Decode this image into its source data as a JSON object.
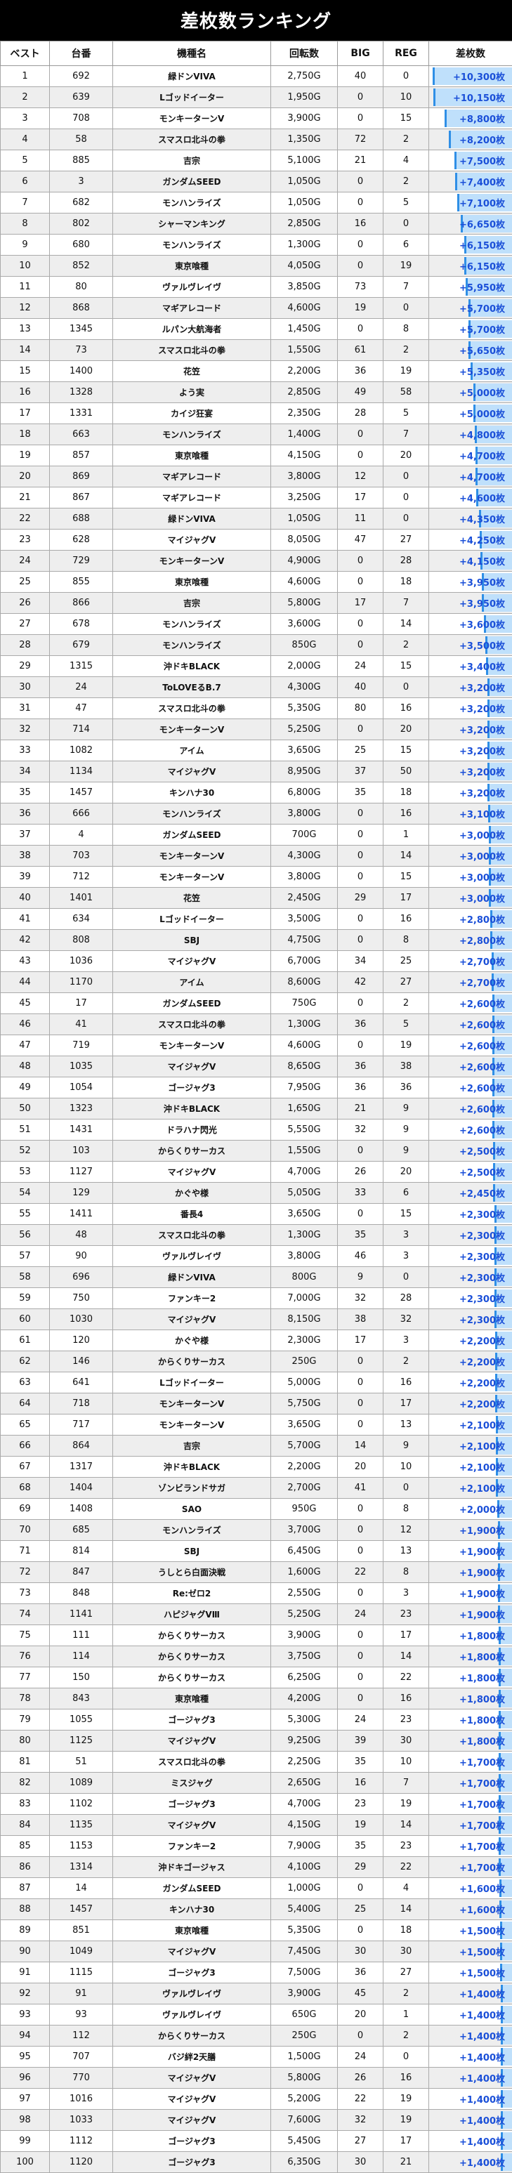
{
  "title": "差枚数ランキング",
  "headers": {
    "rank": "ベスト",
    "no": "台番",
    "name": "機種名",
    "spins": "回転数",
    "big": "BIG",
    "reg": "REG",
    "diff": "差枚数"
  },
  "bar_color": "#bfe0fb",
  "bar_edge_color": "#2f8fe6",
  "value_color": "#1a4fd8",
  "rows": [
    {
      "rank": "1",
      "no": "692",
      "name": "緑ドンVIVA",
      "spins": "2,750G",
      "big": "40",
      "reg": "0",
      "diff": "+10,300枚",
      "level": 1.0
    },
    {
      "rank": "2",
      "no": "639",
      "name": "Lゴッドイーター",
      "spins": "1,950G",
      "big": "0",
      "reg": "10",
      "diff": "+10,150枚",
      "level": 0.99
    },
    {
      "rank": "3",
      "no": "708",
      "name": "モンキーターンV",
      "spins": "3,900G",
      "big": "0",
      "reg": "15",
      "diff": "+8,800枚",
      "level": 0.85
    },
    {
      "rank": "4",
      "no": "58",
      "name": "スマスロ北斗の拳",
      "spins": "1,350G",
      "big": "72",
      "reg": "2",
      "diff": "+8,200枚",
      "level": 0.8
    },
    {
      "rank": "5",
      "no": "885",
      "name": "吉宗",
      "spins": "5,100G",
      "big": "21",
      "reg": "4",
      "diff": "+7,500枚",
      "level": 0.73
    },
    {
      "rank": "6",
      "no": "3",
      "name": "ガンダムSEED",
      "spins": "1,050G",
      "big": "0",
      "reg": "2",
      "diff": "+7,400枚",
      "level": 0.72
    },
    {
      "rank": "7",
      "no": "682",
      "name": "モンハンライズ",
      "spins": "1,050G",
      "big": "0",
      "reg": "5",
      "diff": "+7,100枚",
      "level": 0.69
    },
    {
      "rank": "8",
      "no": "802",
      "name": "シャーマンキング",
      "spins": "2,850G",
      "big": "16",
      "reg": "0",
      "diff": "+6,650枚",
      "level": 0.65
    },
    {
      "rank": "9",
      "no": "680",
      "name": "モンハンライズ",
      "spins": "1,300G",
      "big": "0",
      "reg": "6",
      "diff": "+6,150枚",
      "level": 0.6
    },
    {
      "rank": "10",
      "no": "852",
      "name": "東京喰種",
      "spins": "4,050G",
      "big": "0",
      "reg": "19",
      "diff": "+6,150枚",
      "level": 0.6
    },
    {
      "rank": "11",
      "no": "80",
      "name": "ヴァルヴレイヴ",
      "spins": "3,850G",
      "big": "73",
      "reg": "7",
      "diff": "+5,950枚",
      "level": 0.58
    },
    {
      "rank": "12",
      "no": "868",
      "name": "マギアレコード",
      "spins": "4,600G",
      "big": "19",
      "reg": "0",
      "diff": "+5,700枚",
      "level": 0.55
    },
    {
      "rank": "13",
      "no": "1345",
      "name": "ルパン大航海者",
      "spins": "1,450G",
      "big": "0",
      "reg": "8",
      "diff": "+5,700枚",
      "level": 0.55
    },
    {
      "rank": "14",
      "no": "73",
      "name": "スマスロ北斗の拳",
      "spins": "1,550G",
      "big": "61",
      "reg": "2",
      "diff": "+5,650枚",
      "level": 0.55
    },
    {
      "rank": "15",
      "no": "1400",
      "name": "花笠",
      "spins": "2,200G",
      "big": "36",
      "reg": "19",
      "diff": "+5,350枚",
      "level": 0.52
    },
    {
      "rank": "16",
      "no": "1328",
      "name": "よう実",
      "spins": "2,850G",
      "big": "49",
      "reg": "58",
      "diff": "+5,000枚",
      "level": 0.49
    },
    {
      "rank": "17",
      "no": "1331",
      "name": "カイジ狂宴",
      "spins": "2,350G",
      "big": "28",
      "reg": "5",
      "diff": "+5,000枚",
      "level": 0.49
    },
    {
      "rank": "18",
      "no": "663",
      "name": "モンハンライズ",
      "spins": "1,400G",
      "big": "0",
      "reg": "7",
      "diff": "+4,800枚",
      "level": 0.47
    },
    {
      "rank": "19",
      "no": "857",
      "name": "東京喰種",
      "spins": "4,150G",
      "big": "0",
      "reg": "20",
      "diff": "+4,700枚",
      "level": 0.46
    },
    {
      "rank": "20",
      "no": "869",
      "name": "マギアレコード",
      "spins": "3,800G",
      "big": "12",
      "reg": "0",
      "diff": "+4,700枚",
      "level": 0.46
    },
    {
      "rank": "21",
      "no": "867",
      "name": "マギアレコード",
      "spins": "3,250G",
      "big": "17",
      "reg": "0",
      "diff": "+4,600枚",
      "level": 0.45
    },
    {
      "rank": "22",
      "no": "688",
      "name": "緑ドンVIVA",
      "spins": "1,050G",
      "big": "11",
      "reg": "0",
      "diff": "+4,350枚",
      "level": 0.42
    },
    {
      "rank": "23",
      "no": "628",
      "name": "マイジャグV",
      "spins": "8,050G",
      "big": "47",
      "reg": "27",
      "diff": "+4,250枚",
      "level": 0.41
    },
    {
      "rank": "24",
      "no": "729",
      "name": "モンキーターンV",
      "spins": "4,900G",
      "big": "0",
      "reg": "28",
      "diff": "+4,150枚",
      "level": 0.4
    },
    {
      "rank": "25",
      "no": "855",
      "name": "東京喰種",
      "spins": "4,600G",
      "big": "0",
      "reg": "18",
      "diff": "+3,950枚",
      "level": 0.38
    },
    {
      "rank": "26",
      "no": "866",
      "name": "吉宗",
      "spins": "5,800G",
      "big": "17",
      "reg": "7",
      "diff": "+3,950枚",
      "level": 0.38
    },
    {
      "rank": "27",
      "no": "678",
      "name": "モンハンライズ",
      "spins": "3,600G",
      "big": "0",
      "reg": "14",
      "diff": "+3,600枚",
      "level": 0.35
    },
    {
      "rank": "28",
      "no": "679",
      "name": "モンハンライズ",
      "spins": "850G",
      "big": "0",
      "reg": "2",
      "diff": "+3,500枚",
      "level": 0.34
    },
    {
      "rank": "29",
      "no": "1315",
      "name": "沖ドキBLACK",
      "spins": "2,000G",
      "big": "24",
      "reg": "15",
      "diff": "+3,400枚",
      "level": 0.33
    },
    {
      "rank": "30",
      "no": "24",
      "name": "ToLOVEるB.7",
      "spins": "4,300G",
      "big": "40",
      "reg": "0",
      "diff": "+3,200枚",
      "level": 0.31
    },
    {
      "rank": "31",
      "no": "47",
      "name": "スマスロ北斗の拳",
      "spins": "5,350G",
      "big": "80",
      "reg": "16",
      "diff": "+3,200枚",
      "level": 0.31
    },
    {
      "rank": "32",
      "no": "714",
      "name": "モンキーターンV",
      "spins": "5,250G",
      "big": "0",
      "reg": "20",
      "diff": "+3,200枚",
      "level": 0.31
    },
    {
      "rank": "33",
      "no": "1082",
      "name": "アイム",
      "spins": "3,650G",
      "big": "25",
      "reg": "15",
      "diff": "+3,200枚",
      "level": 0.31
    },
    {
      "rank": "34",
      "no": "1134",
      "name": "マイジャグV",
      "spins": "8,950G",
      "big": "37",
      "reg": "50",
      "diff": "+3,200枚",
      "level": 0.31
    },
    {
      "rank": "35",
      "no": "1457",
      "name": "キンハナ30",
      "spins": "6,800G",
      "big": "35",
      "reg": "18",
      "diff": "+3,200枚",
      "level": 0.31
    },
    {
      "rank": "36",
      "no": "666",
      "name": "モンハンライズ",
      "spins": "3,800G",
      "big": "0",
      "reg": "16",
      "diff": "+3,100枚",
      "level": 0.3
    },
    {
      "rank": "37",
      "no": "4",
      "name": "ガンダムSEED",
      "spins": "700G",
      "big": "0",
      "reg": "1",
      "diff": "+3,000枚",
      "level": 0.29
    },
    {
      "rank": "38",
      "no": "703",
      "name": "モンキーターンV",
      "spins": "4,300G",
      "big": "0",
      "reg": "14",
      "diff": "+3,000枚",
      "level": 0.29
    },
    {
      "rank": "39",
      "no": "712",
      "name": "モンキーターンV",
      "spins": "3,800G",
      "big": "0",
      "reg": "15",
      "diff": "+3,000枚",
      "level": 0.29
    },
    {
      "rank": "40",
      "no": "1401",
      "name": "花笠",
      "spins": "2,450G",
      "big": "29",
      "reg": "17",
      "diff": "+3,000枚",
      "level": 0.29
    },
    {
      "rank": "41",
      "no": "634",
      "name": "Lゴッドイーター",
      "spins": "3,500G",
      "big": "0",
      "reg": "16",
      "diff": "+2,800枚",
      "level": 0.27
    },
    {
      "rank": "42",
      "no": "808",
      "name": "SBJ",
      "spins": "4,750G",
      "big": "0",
      "reg": "8",
      "diff": "+2,800枚",
      "level": 0.27
    },
    {
      "rank": "43",
      "no": "1036",
      "name": "マイジャグV",
      "spins": "6,700G",
      "big": "34",
      "reg": "25",
      "diff": "+2,700枚",
      "level": 0.26
    },
    {
      "rank": "44",
      "no": "1170",
      "name": "アイム",
      "spins": "8,600G",
      "big": "42",
      "reg": "27",
      "diff": "+2,700枚",
      "level": 0.26
    },
    {
      "rank": "45",
      "no": "17",
      "name": "ガンダムSEED",
      "spins": "750G",
      "big": "0",
      "reg": "2",
      "diff": "+2,600枚",
      "level": 0.25
    },
    {
      "rank": "46",
      "no": "41",
      "name": "スマスロ北斗の拳",
      "spins": "1,300G",
      "big": "36",
      "reg": "5",
      "diff": "+2,600枚",
      "level": 0.25
    },
    {
      "rank": "47",
      "no": "719",
      "name": "モンキーターンV",
      "spins": "4,600G",
      "big": "0",
      "reg": "19",
      "diff": "+2,600枚",
      "level": 0.25
    },
    {
      "rank": "48",
      "no": "1035",
      "name": "マイジャグV",
      "spins": "8,650G",
      "big": "36",
      "reg": "38",
      "diff": "+2,600枚",
      "level": 0.25
    },
    {
      "rank": "49",
      "no": "1054",
      "name": "ゴージャグ3",
      "spins": "7,950G",
      "big": "36",
      "reg": "36",
      "diff": "+2,600枚",
      "level": 0.25
    },
    {
      "rank": "50",
      "no": "1323",
      "name": "沖ドキBLACK",
      "spins": "1,650G",
      "big": "21",
      "reg": "9",
      "diff": "+2,600枚",
      "level": 0.25
    },
    {
      "rank": "51",
      "no": "1431",
      "name": "ドラハナ閃光",
      "spins": "5,550G",
      "big": "32",
      "reg": "9",
      "diff": "+2,600枚",
      "level": 0.25
    },
    {
      "rank": "52",
      "no": "103",
      "name": "からくりサーカス",
      "spins": "1,550G",
      "big": "0",
      "reg": "9",
      "diff": "+2,500枚",
      "level": 0.24
    },
    {
      "rank": "53",
      "no": "1127",
      "name": "マイジャグV",
      "spins": "4,700G",
      "big": "26",
      "reg": "20",
      "diff": "+2,500枚",
      "level": 0.24
    },
    {
      "rank": "54",
      "no": "129",
      "name": "かぐや様",
      "spins": "5,050G",
      "big": "33",
      "reg": "6",
      "diff": "+2,450枚",
      "level": 0.24
    },
    {
      "rank": "55",
      "no": "1411",
      "name": "番長4",
      "spins": "3,650G",
      "big": "0",
      "reg": "15",
      "diff": "+2,300枚",
      "level": 0.22
    },
    {
      "rank": "56",
      "no": "48",
      "name": "スマスロ北斗の拳",
      "spins": "1,300G",
      "big": "35",
      "reg": "3",
      "diff": "+2,300枚",
      "level": 0.22
    },
    {
      "rank": "57",
      "no": "90",
      "name": "ヴァルヴレイヴ",
      "spins": "3,800G",
      "big": "46",
      "reg": "3",
      "diff": "+2,300枚",
      "level": 0.22
    },
    {
      "rank": "58",
      "no": "696",
      "name": "緑ドンVIVA",
      "spins": "800G",
      "big": "9",
      "reg": "0",
      "diff": "+2,300枚",
      "level": 0.22
    },
    {
      "rank": "59",
      "no": "750",
      "name": "ファンキー2",
      "spins": "7,000G",
      "big": "32",
      "reg": "28",
      "diff": "+2,300枚",
      "level": 0.22
    },
    {
      "rank": "60",
      "no": "1030",
      "name": "マイジャグV",
      "spins": "8,150G",
      "big": "38",
      "reg": "32",
      "diff": "+2,300枚",
      "level": 0.22
    },
    {
      "rank": "61",
      "no": "120",
      "name": "かぐや様",
      "spins": "2,300G",
      "big": "17",
      "reg": "3",
      "diff": "+2,200枚",
      "level": 0.21
    },
    {
      "rank": "62",
      "no": "146",
      "name": "からくりサーカス",
      "spins": "250G",
      "big": "0",
      "reg": "2",
      "diff": "+2,200枚",
      "level": 0.21
    },
    {
      "rank": "63",
      "no": "641",
      "name": "Lゴッドイーター",
      "spins": "5,000G",
      "big": "0",
      "reg": "16",
      "diff": "+2,200枚",
      "level": 0.21
    },
    {
      "rank": "64",
      "no": "718",
      "name": "モンキーターンV",
      "spins": "5,750G",
      "big": "0",
      "reg": "17",
      "diff": "+2,200枚",
      "level": 0.21
    },
    {
      "rank": "65",
      "no": "717",
      "name": "モンキーターンV",
      "spins": "3,650G",
      "big": "0",
      "reg": "13",
      "diff": "+2,100枚",
      "level": 0.2
    },
    {
      "rank": "66",
      "no": "864",
      "name": "吉宗",
      "spins": "5,700G",
      "big": "14",
      "reg": "9",
      "diff": "+2,100枚",
      "level": 0.2
    },
    {
      "rank": "67",
      "no": "1317",
      "name": "沖ドキBLACK",
      "spins": "2,200G",
      "big": "20",
      "reg": "10",
      "diff": "+2,100枚",
      "level": 0.2
    },
    {
      "rank": "68",
      "no": "1404",
      "name": "ゾンビランドサガ",
      "spins": "2,700G",
      "big": "41",
      "reg": "0",
      "diff": "+2,100枚",
      "level": 0.2
    },
    {
      "rank": "69",
      "no": "1408",
      "name": "SAO",
      "spins": "950G",
      "big": "0",
      "reg": "8",
      "diff": "+2,000枚",
      "level": 0.19
    },
    {
      "rank": "70",
      "no": "685",
      "name": "モンハンライズ",
      "spins": "3,700G",
      "big": "0",
      "reg": "12",
      "diff": "+1,900枚",
      "level": 0.18
    },
    {
      "rank": "71",
      "no": "814",
      "name": "SBJ",
      "spins": "6,450G",
      "big": "0",
      "reg": "13",
      "diff": "+1,900枚",
      "level": 0.18
    },
    {
      "rank": "72",
      "no": "847",
      "name": "うしとら白面決戦",
      "spins": "1,600G",
      "big": "22",
      "reg": "8",
      "diff": "+1,900枚",
      "level": 0.18
    },
    {
      "rank": "73",
      "no": "848",
      "name": "Re:ゼロ2",
      "spins": "2,550G",
      "big": "0",
      "reg": "3",
      "diff": "+1,900枚",
      "level": 0.18
    },
    {
      "rank": "74",
      "no": "1141",
      "name": "ハピジャグVⅢ",
      "spins": "5,250G",
      "big": "24",
      "reg": "23",
      "diff": "+1,900枚",
      "level": 0.18
    },
    {
      "rank": "75",
      "no": "111",
      "name": "からくりサーカス",
      "spins": "3,900G",
      "big": "0",
      "reg": "17",
      "diff": "+1,800枚",
      "level": 0.17
    },
    {
      "rank": "76",
      "no": "114",
      "name": "からくりサーカス",
      "spins": "3,750G",
      "big": "0",
      "reg": "14",
      "diff": "+1,800枚",
      "level": 0.17
    },
    {
      "rank": "77",
      "no": "150",
      "name": "からくりサーカス",
      "spins": "6,250G",
      "big": "0",
      "reg": "22",
      "diff": "+1,800枚",
      "level": 0.17
    },
    {
      "rank": "78",
      "no": "843",
      "name": "東京喰種",
      "spins": "4,200G",
      "big": "0",
      "reg": "16",
      "diff": "+1,800枚",
      "level": 0.17
    },
    {
      "rank": "79",
      "no": "1055",
      "name": "ゴージャグ3",
      "spins": "5,300G",
      "big": "24",
      "reg": "23",
      "diff": "+1,800枚",
      "level": 0.17
    },
    {
      "rank": "80",
      "no": "1125",
      "name": "マイジャグV",
      "spins": "9,250G",
      "big": "39",
      "reg": "30",
      "diff": "+1,800枚",
      "level": 0.17
    },
    {
      "rank": "81",
      "no": "51",
      "name": "スマスロ北斗の拳",
      "spins": "2,250G",
      "big": "35",
      "reg": "10",
      "diff": "+1,700枚",
      "level": 0.17
    },
    {
      "rank": "82",
      "no": "1089",
      "name": "ミスジャグ",
      "spins": "2,650G",
      "big": "16",
      "reg": "7",
      "diff": "+1,700枚",
      "level": 0.17
    },
    {
      "rank": "83",
      "no": "1102",
      "name": "ゴージャグ3",
      "spins": "4,700G",
      "big": "23",
      "reg": "19",
      "diff": "+1,700枚",
      "level": 0.17
    },
    {
      "rank": "84",
      "no": "1135",
      "name": "マイジャグV",
      "spins": "4,150G",
      "big": "19",
      "reg": "14",
      "diff": "+1,700枚",
      "level": 0.17
    },
    {
      "rank": "85",
      "no": "1153",
      "name": "ファンキー2",
      "spins": "7,900G",
      "big": "35",
      "reg": "23",
      "diff": "+1,700枚",
      "level": 0.17
    },
    {
      "rank": "86",
      "no": "1314",
      "name": "沖ドキゴージャス",
      "spins": "4,100G",
      "big": "29",
      "reg": "22",
      "diff": "+1,700枚",
      "level": 0.17
    },
    {
      "rank": "87",
      "no": "14",
      "name": "ガンダムSEED",
      "spins": "1,000G",
      "big": "0",
      "reg": "4",
      "diff": "+1,600枚",
      "level": 0.16
    },
    {
      "rank": "88",
      "no": "1457",
      "name": "キンハナ30",
      "spins": "5,400G",
      "big": "25",
      "reg": "14",
      "diff": "+1,600枚",
      "level": 0.16
    },
    {
      "rank": "89",
      "no": "851",
      "name": "東京喰種",
      "spins": "5,350G",
      "big": "0",
      "reg": "18",
      "diff": "+1,500枚",
      "level": 0.15
    },
    {
      "rank": "90",
      "no": "1049",
      "name": "マイジャグV",
      "spins": "7,450G",
      "big": "30",
      "reg": "30",
      "diff": "+1,500枚",
      "level": 0.15
    },
    {
      "rank": "91",
      "no": "1115",
      "name": "ゴージャグ3",
      "spins": "7,500G",
      "big": "36",
      "reg": "27",
      "diff": "+1,500枚",
      "level": 0.15
    },
    {
      "rank": "92",
      "no": "91",
      "name": "ヴァルヴレイヴ",
      "spins": "3,900G",
      "big": "45",
      "reg": "2",
      "diff": "+1,400枚",
      "level": 0.14
    },
    {
      "rank": "93",
      "no": "93",
      "name": "ヴァルヴレイヴ",
      "spins": "650G",
      "big": "20",
      "reg": "1",
      "diff": "+1,400枚",
      "level": 0.14
    },
    {
      "rank": "94",
      "no": "112",
      "name": "からくりサーカス",
      "spins": "250G",
      "big": "0",
      "reg": "2",
      "diff": "+1,400枚",
      "level": 0.14
    },
    {
      "rank": "95",
      "no": "707",
      "name": "バジ絆2天膳",
      "spins": "1,500G",
      "big": "24",
      "reg": "0",
      "diff": "+1,400枚",
      "level": 0.14
    },
    {
      "rank": "96",
      "no": "770",
      "name": "マイジャグV",
      "spins": "5,800G",
      "big": "26",
      "reg": "16",
      "diff": "+1,400枚",
      "level": 0.14
    },
    {
      "rank": "97",
      "no": "1016",
      "name": "マイジャグV",
      "spins": "5,200G",
      "big": "22",
      "reg": "19",
      "diff": "+1,400枚",
      "level": 0.14
    },
    {
      "rank": "98",
      "no": "1033",
      "name": "マイジャグV",
      "spins": "7,600G",
      "big": "32",
      "reg": "19",
      "diff": "+1,400枚",
      "level": 0.14
    },
    {
      "rank": "99",
      "no": "1112",
      "name": "ゴージャグ3",
      "spins": "5,450G",
      "big": "27",
      "reg": "17",
      "diff": "+1,400枚",
      "level": 0.14
    },
    {
      "rank": "100",
      "no": "1120",
      "name": "ゴージャグ3",
      "spins": "6,350G",
      "big": "30",
      "reg": "21",
      "diff": "+1,400枚",
      "level": 0.14
    }
  ]
}
